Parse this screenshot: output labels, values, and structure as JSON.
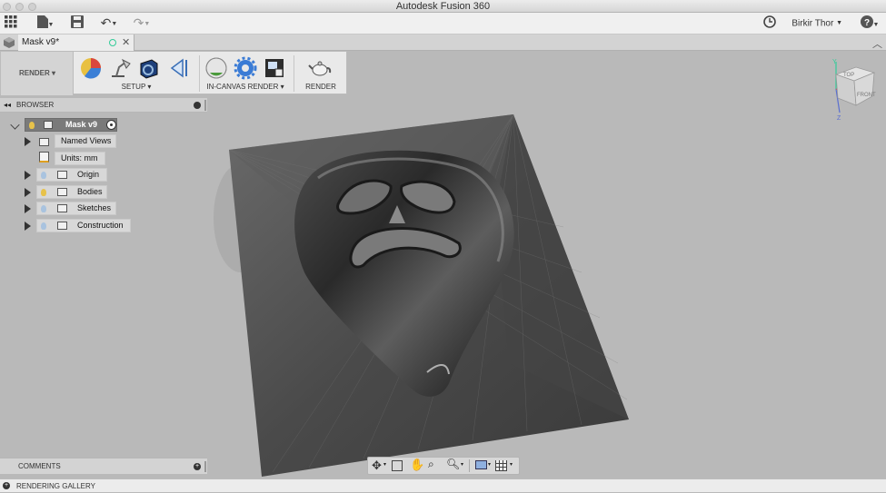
{
  "window": {
    "title": "Autodesk Fusion 360"
  },
  "app_toolbar": {
    "user_name": "Birkir Thor"
  },
  "document_tab": {
    "label": "Mask v9*"
  },
  "ribbon": {
    "workspace": "RENDER",
    "groups": [
      {
        "label": "SETUP"
      },
      {
        "label": "IN-CANVAS RENDER"
      },
      {
        "label": "RENDER"
      }
    ]
  },
  "browser": {
    "title": "BROWSER",
    "root": "Mask v9",
    "items": [
      {
        "label": "Named Views",
        "icon": "folder-icon"
      },
      {
        "label": "Units: mm",
        "icon": "document-icon"
      },
      {
        "label": "Origin",
        "icon": "folder-icon"
      },
      {
        "label": "Bodies",
        "icon": "folder-icon"
      },
      {
        "label": "Sketches",
        "icon": "folder-icon"
      },
      {
        "label": "Construction",
        "icon": "folder-icon"
      }
    ]
  },
  "viewcube": {
    "top": "TOP",
    "front": "FRONT"
  },
  "bottom": {
    "comments": "COMMENTS",
    "gallery": "RENDERING GALLERY"
  },
  "colors": {
    "viewport": "#b9b9b9",
    "ribbon": "#e9e9e9",
    "accent_blue": "#3a7bd5"
  }
}
